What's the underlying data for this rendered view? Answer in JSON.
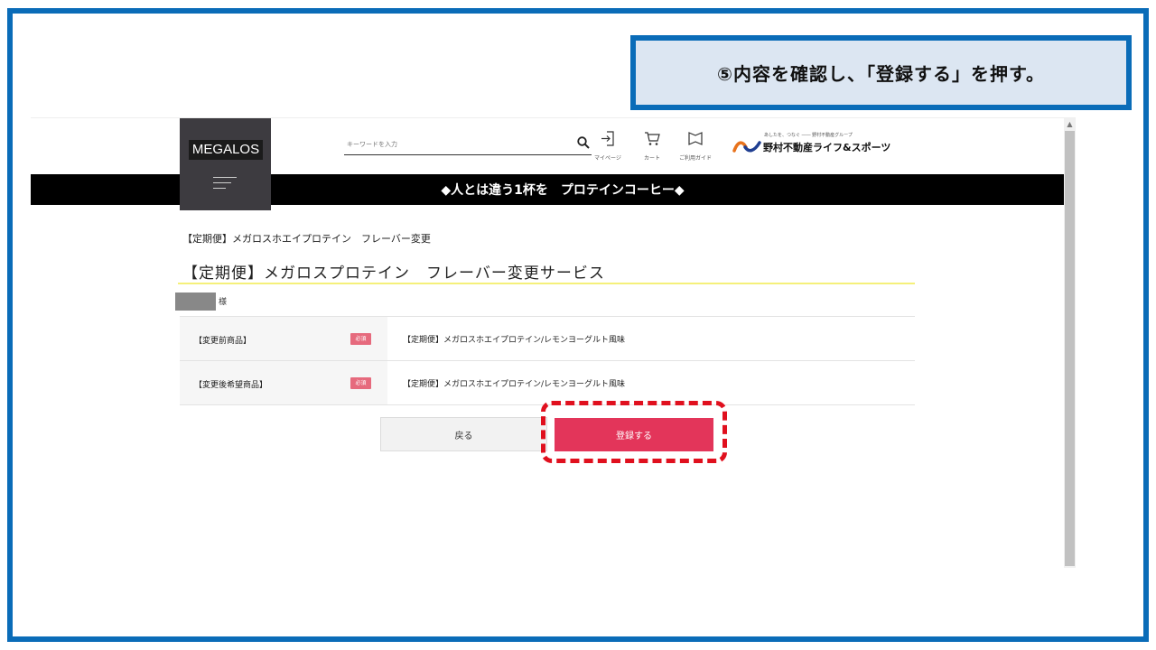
{
  "callout": {
    "text": "⑤内容を確認し、「登録する」を押す。"
  },
  "site": {
    "logo": "MEGALOS",
    "search": {
      "placeholder": "キーワードを入力",
      "icon": "search-icon"
    },
    "header_links": [
      {
        "label": "マイページ",
        "icon": "login-icon"
      },
      {
        "label": "カート",
        "icon": "cart-icon"
      },
      {
        "label": "ご利用ガイド",
        "icon": "guide-icon"
      }
    ],
    "brand": {
      "tagline": "あしたを、つなぐ ―― 野村不動産グループ",
      "name": "野村不動産ライフ&スポーツ"
    },
    "banner": "◆人とは違う1杯を　プロテインコーヒー◆"
  },
  "page": {
    "breadcrumb": "【定期便】メガロスホエイプロテイン　フレーバー変更",
    "title": "【定期便】メガロスプロテイン　フレーバー変更サービス",
    "user_suffix": "様",
    "rows": [
      {
        "label": "【変更前商品】",
        "badge": "必須",
        "value": "【定期便】メガロスホエイプロテイン/レモンヨーグルト風味"
      },
      {
        "label": "【変更後希望商品】",
        "badge": "必須",
        "value": "【定期便】メガロスホエイプロテイン/レモンヨーグルト風味"
      }
    ],
    "buttons": {
      "back": "戻る",
      "submit": "登録する"
    }
  },
  "colors": {
    "frame": "#0a6cb8",
    "submit": "#e3355a",
    "highlight": "#e0101e",
    "callout_bg": "#dce6f2"
  }
}
